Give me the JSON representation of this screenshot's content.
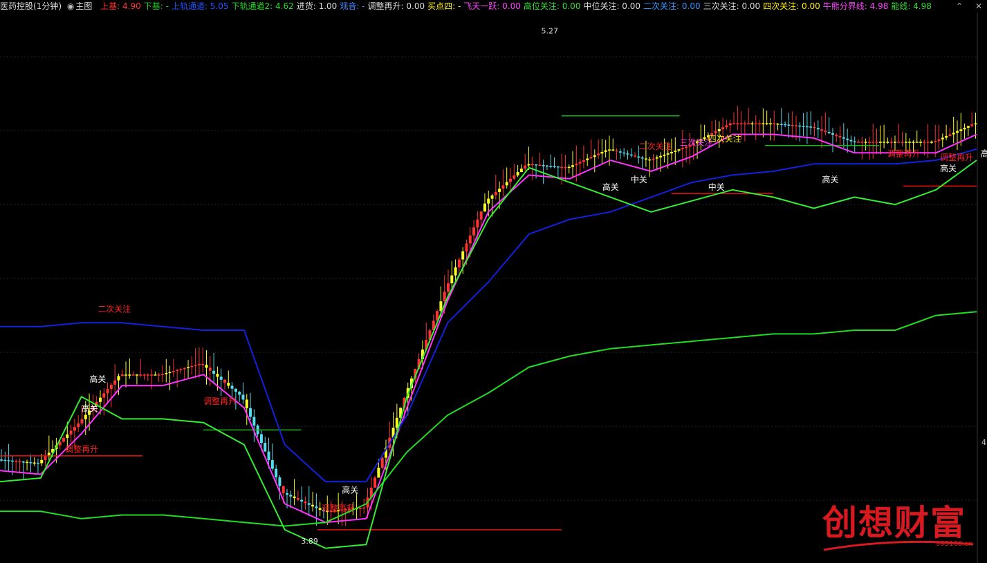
{
  "header": {
    "title": "医药控股(1分钟)",
    "main_label": "主图",
    "indicators": [
      {
        "name": "上基",
        "value": "4.90",
        "color": "#ff3333"
      },
      {
        "name": "下基",
        "value": "-",
        "color": "#22cc22"
      },
      {
        "name": "上轨通道",
        "value": "5.05",
        "color": "#2255ff"
      },
      {
        "name": "下轨通道2",
        "value": "4.62",
        "color": "#22dd22"
      },
      {
        "name": "进货",
        "value": "1.00",
        "color": "#dddddd"
      },
      {
        "name": "观音",
        "value": "-",
        "color": "#4488ff"
      },
      {
        "name": "调整再升",
        "value": "0.00",
        "color": "#dddddd"
      },
      {
        "name": "买点四",
        "value": "-",
        "color": "#ffee00"
      },
      {
        "name": "飞天一跃",
        "value": "0.00",
        "color": "#ff44ff"
      },
      {
        "name": "高位关注",
        "value": "0.00",
        "color": "#33dd33"
      },
      {
        "name": "中位关注",
        "value": "0.00",
        "color": "#dddddd"
      },
      {
        "name": "二次关注",
        "value": "0.00",
        "color": "#3399ff"
      },
      {
        "name": "三次关注",
        "value": "0.00",
        "color": "#dddddd"
      },
      {
        "name": "四次关注",
        "value": "0.00",
        "color": "#ffee00"
      },
      {
        "name": "牛熊分界线",
        "value": "4.98",
        "color": "#ff44ff"
      },
      {
        "name": "能线",
        "value": "4.98",
        "color": "#33dd33"
      }
    ],
    "axis_right_label": "4."
  },
  "chart_data": {
    "type": "line",
    "x": [
      0,
      10,
      20,
      30,
      40,
      50,
      60,
      70,
      80,
      90,
      100,
      110,
      120,
      130,
      140,
      150,
      160,
      170,
      180,
      190,
      200,
      210,
      220,
      230,
      240
    ],
    "ylim": [
      3.83,
      5.32
    ],
    "annotations_price": {
      "high": "5.27",
      "low": "3.89"
    },
    "series": [
      {
        "name": "牛熊分界线",
        "color": "#ff33ff",
        "values": [
          4.08,
          4.07,
          4.18,
          4.31,
          4.31,
          4.34,
          4.25,
          3.99,
          3.94,
          3.95,
          4.25,
          4.54,
          4.78,
          4.88,
          4.87,
          4.92,
          4.89,
          4.93,
          4.99,
          4.99,
          4.98,
          4.94,
          4.94,
          4.94,
          4.99
        ]
      },
      {
        "name": "上轨通道",
        "color": "#1122dd",
        "values": [
          4.47,
          4.47,
          4.48,
          4.48,
          4.47,
          4.46,
          4.46,
          4.15,
          4.05,
          4.05,
          4.23,
          4.48,
          4.59,
          4.72,
          4.76,
          4.78,
          4.82,
          4.86,
          4.88,
          4.89,
          4.91,
          4.91,
          4.91,
          4.92,
          4.95
        ]
      },
      {
        "name": "下轨通道2",
        "color": "#22dd22",
        "values": [
          3.97,
          3.97,
          3.95,
          3.96,
          3.96,
          3.95,
          3.94,
          3.93,
          3.94,
          3.99,
          4.13,
          4.23,
          4.29,
          4.36,
          4.39,
          4.41,
          4.42,
          4.43,
          4.44,
          4.45,
          4.45,
          4.46,
          4.46,
          4.5,
          4.51
        ]
      },
      {
        "name": "能线",
        "color": "#33ee33",
        "values": [
          4.05,
          4.06,
          4.28,
          4.22,
          4.22,
          4.21,
          4.15,
          3.92,
          3.87,
          3.88,
          4.28,
          4.55,
          4.76,
          4.9,
          4.86,
          4.82,
          4.78,
          4.81,
          4.84,
          4.82,
          4.79,
          4.82,
          4.8,
          4.84,
          4.92
        ]
      }
    ],
    "level_lines": [
      {
        "color": "#ee1111",
        "y": 4.12,
        "x1": 0,
        "x2": 35
      },
      {
        "color": "#11bb11",
        "y": 4.19,
        "x1": 50,
        "x2": 74
      },
      {
        "color": "#ee1111",
        "y": 3.92,
        "x1": 78,
        "x2": 138
      },
      {
        "color": "#11bb11",
        "y": 5.04,
        "x1": 138,
        "x2": 167
      },
      {
        "color": "#ee1111",
        "y": 4.83,
        "x1": 165,
        "x2": 190
      },
      {
        "color": "#11bb11",
        "y": 4.96,
        "x1": 188,
        "x2": 216
      },
      {
        "color": "#ee1111",
        "y": 4.85,
        "x1": 222,
        "x2": 240
      }
    ],
    "labels": [
      {
        "text": "二次关注",
        "color": "#ff2222",
        "x": 24,
        "y": 4.51
      },
      {
        "text": "高关",
        "color": "#ffffff",
        "x": 22,
        "y": 4.32
      },
      {
        "text": "高关",
        "color": "#ffffff",
        "x": 20,
        "y": 4.24
      },
      {
        "text": "调整再升",
        "color": "#ff2222",
        "x": 50,
        "y": 4.26
      },
      {
        "text": "调整再升",
        "color": "#ff2222",
        "x": 16,
        "y": 4.13
      },
      {
        "text": "高关",
        "color": "#ffffff",
        "x": 84,
        "y": 4.02
      },
      {
        "text": "调整再升",
        "color": "#ff2222",
        "x": 79,
        "y": 3.97
      },
      {
        "text": "二次关注",
        "color": "#ff2222",
        "x": 157,
        "y": 4.95
      },
      {
        "text": "三次关注",
        "color": "#ff33ff",
        "x": 167,
        "y": 4.96
      },
      {
        "text": "四次关注",
        "color": "#ffee00",
        "x": 174,
        "y": 4.97
      },
      {
        "text": "高关",
        "color": "#ffffff",
        "x": 148,
        "y": 4.84
      },
      {
        "text": "中关",
        "color": "#ffffff",
        "x": 155,
        "y": 4.86
      },
      {
        "text": "中关",
        "color": "#ffffff",
        "x": 174,
        "y": 4.84
      },
      {
        "text": "高关",
        "color": "#ffffff",
        "x": 202,
        "y": 4.86
      },
      {
        "text": "调整再升",
        "color": "#ff2222",
        "x": 218,
        "y": 4.93
      },
      {
        "text": "调整再升",
        "color": "#ff2222",
        "x": 231,
        "y": 4.92
      },
      {
        "text": "高关",
        "color": "#ffffff",
        "x": 231,
        "y": 4.89
      },
      {
        "text": "高关",
        "color": "#ffffff",
        "x": 241,
        "y": 4.93
      }
    ]
  },
  "watermark": {
    "text": "创想财富",
    "url": "995168.cn"
  }
}
